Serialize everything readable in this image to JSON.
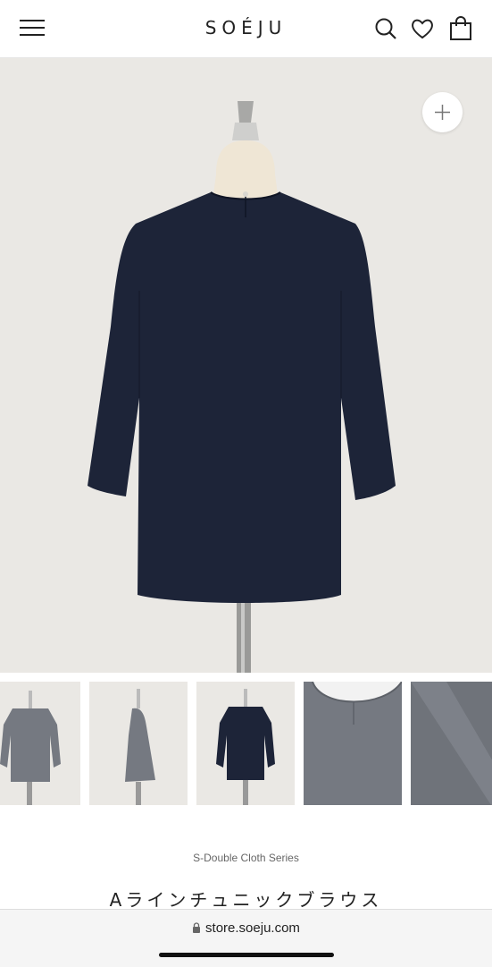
{
  "header": {
    "logo": "SOÉJU",
    "icons": [
      "menu-icon",
      "search-icon",
      "heart-icon",
      "shopping-bag-icon"
    ]
  },
  "gallery": {
    "zoom_icon": "plus-icon",
    "thumbnails": [
      {
        "name": "front-gray"
      },
      {
        "name": "side-gray"
      },
      {
        "name": "back-navy"
      },
      {
        "name": "collar-detail"
      },
      {
        "name": "fabric-detail"
      }
    ]
  },
  "product": {
    "series": "S-Double Cloth Series",
    "title": "Aラインチュニックブラウス"
  },
  "browser": {
    "url": "store.soeju.com"
  },
  "colors": {
    "navy": "#1d2438",
    "gray": "#757981",
    "background": "#eae8e4"
  }
}
